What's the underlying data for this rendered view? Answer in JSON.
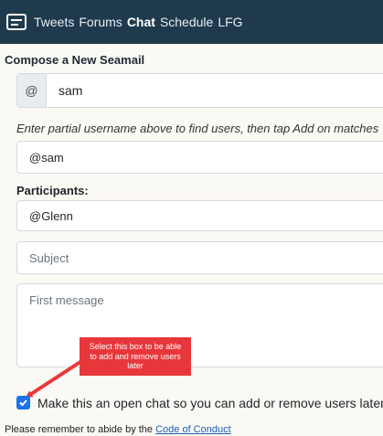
{
  "nav": {
    "items": [
      {
        "label": "Tweets",
        "active": false
      },
      {
        "label": "Forums",
        "active": false
      },
      {
        "label": "Chat",
        "active": true
      },
      {
        "label": "Schedule",
        "active": false
      },
      {
        "label": "LFG",
        "active": false
      }
    ]
  },
  "form": {
    "title": "Compose a New Seamail",
    "user_search": {
      "prefix": "@",
      "value": "sam"
    },
    "hint": "Enter partial username above to find users, then tap Add on matches",
    "match": "@sam",
    "participants_label": "Participants:",
    "participants": [
      "@Glenn"
    ],
    "subject_placeholder": "Subject",
    "message_placeholder": "First message",
    "open_chat": {
      "checked": true,
      "label": "Make this an open chat so you can add or remove users later"
    },
    "remember_text": "Please remember to abide by the ",
    "conduct_link": "Code of Conduct"
  },
  "annotation": {
    "text": "Select this box to be able to add and remove users later",
    "color": "#e8373b"
  },
  "colors": {
    "navbar": "#1f3a4d",
    "checkbox": "#1a73e8",
    "link": "#1a5fb4"
  }
}
